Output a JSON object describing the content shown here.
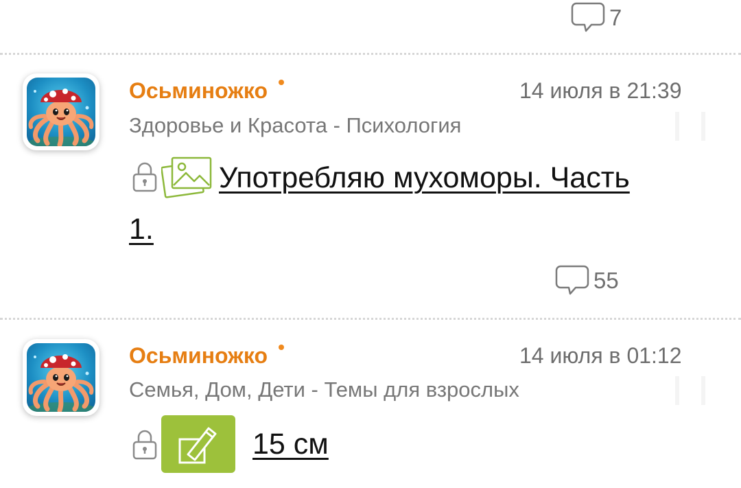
{
  "top_item": {
    "comments_count": "7"
  },
  "posts": [
    {
      "author": "Осьминожко",
      "date": "14 июля в 21:39",
      "category": "Здоровье и Красота - Психология",
      "title_line1": "Употребляю мухоморы. Часть",
      "title_line2": "1.",
      "comments_count": "55",
      "icons": [
        "lock-icon",
        "image-icon"
      ]
    },
    {
      "author": "Осьминожко",
      "date": "14 июля в 01:12",
      "category": "Семья, Дом, Дети - Темы для взрослых",
      "title": "15 см",
      "icons": [
        "lock-icon",
        "poll-icon"
      ]
    }
  ],
  "colors": {
    "author": "#e67e12",
    "meta_text": "#6d6d6d",
    "poll_badge": "#9dc13b",
    "image_icon": "#8cb83a",
    "divider": "#d6d6d6"
  }
}
